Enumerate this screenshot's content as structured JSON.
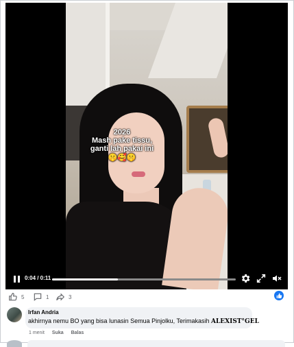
{
  "video": {
    "caption_year": "2026",
    "caption_line1": "Mash pake tissu,",
    "caption_line2": "ganti lah pakai ini",
    "caption_emojis": "🤫🥰🤫",
    "time_current": "0:04",
    "time_total": "0:11",
    "time_display": "0:04 / 0:11",
    "progress": 0.36
  },
  "actions": {
    "like_count": "5",
    "comment_count": "1",
    "share_count": "3"
  },
  "comment": {
    "author": "Irfan Andria",
    "text_prefix": "akhirnya nemu BO yang bisa lunasin Semua Pinjolku, Terimakasih ",
    "text_brand": "ALEXIST°GEL",
    "time": "1 menit",
    "like_label": "Suka",
    "reply_label": "Balas"
  },
  "colors": {
    "accent": "#1877f2",
    "muted_text": "#65676b",
    "bubble_bg": "#f0f2f5"
  }
}
